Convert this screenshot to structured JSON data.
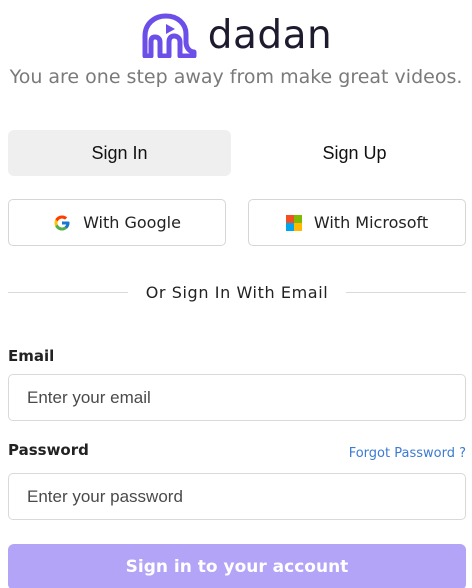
{
  "brand": {
    "name": "dadan",
    "tagline": "You are one step away from make great videos.",
    "logo_color": "#6c4ee8"
  },
  "tabs": [
    {
      "label": "Sign In",
      "active": true
    },
    {
      "label": "Sign Up",
      "active": false
    }
  ],
  "social": {
    "google_label": "With Google",
    "microsoft_label": "With Microsoft"
  },
  "divider_text": "Or Sign In With Email",
  "form": {
    "email_label": "Email",
    "email_placeholder": "Enter your email",
    "password_label": "Password",
    "password_placeholder": "Enter your password",
    "forgot_label": "Forgot Password ?",
    "submit_label": "Sign in to your account"
  },
  "colors": {
    "primary_button": "#b3a4f7",
    "link": "#3c7bd1"
  }
}
